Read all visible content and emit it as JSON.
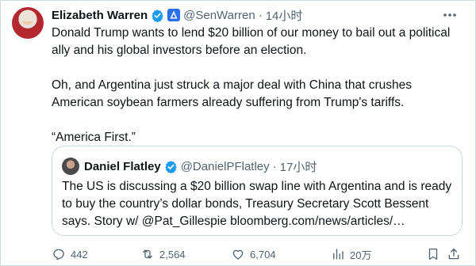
{
  "tweet": {
    "author_name": "Elizabeth Warren",
    "author_handle": "@SenWarren",
    "separator": "·",
    "timestamp": "14小时",
    "paragraphs": [
      "Donald Trump wants to lend $20 billion of our money to bail out a political",
      "ally and his global investors before an election.",
      "Oh, and Argentina just struck a major deal with China that crushes",
      "American soybean farmers already suffering from Trump's tariffs.",
      "“America First.”"
    ]
  },
  "quote": {
    "author_name": "Daniel Flatley",
    "author_handle": "@DanielPFlatley",
    "separator": "·",
    "timestamp": "17小时",
    "lines": [
      "The US is discussing a $20 billion swap line with Argentina and is ready",
      "to buy the country’s dollar bonds, Treasury Secretary Scott Bessent",
      "says. Story w/ @Pat_Gillespie  bloomberg.com/news/articles/…"
    ]
  },
  "actions": {
    "replies": "442",
    "retweets": "2,564",
    "likes": "6,704",
    "views": "20万"
  },
  "colors": {
    "verified_blue": "#1d9bf0",
    "gov_badge_blue": "#2b6ef0",
    "muted_text": "#536471",
    "border": "#cfd9de"
  },
  "icons": [
    "verified-icon",
    "government-icon",
    "more-icon",
    "reply-icon",
    "retweet-icon",
    "like-icon",
    "views-icon",
    "bookmark-icon",
    "share-icon"
  ]
}
